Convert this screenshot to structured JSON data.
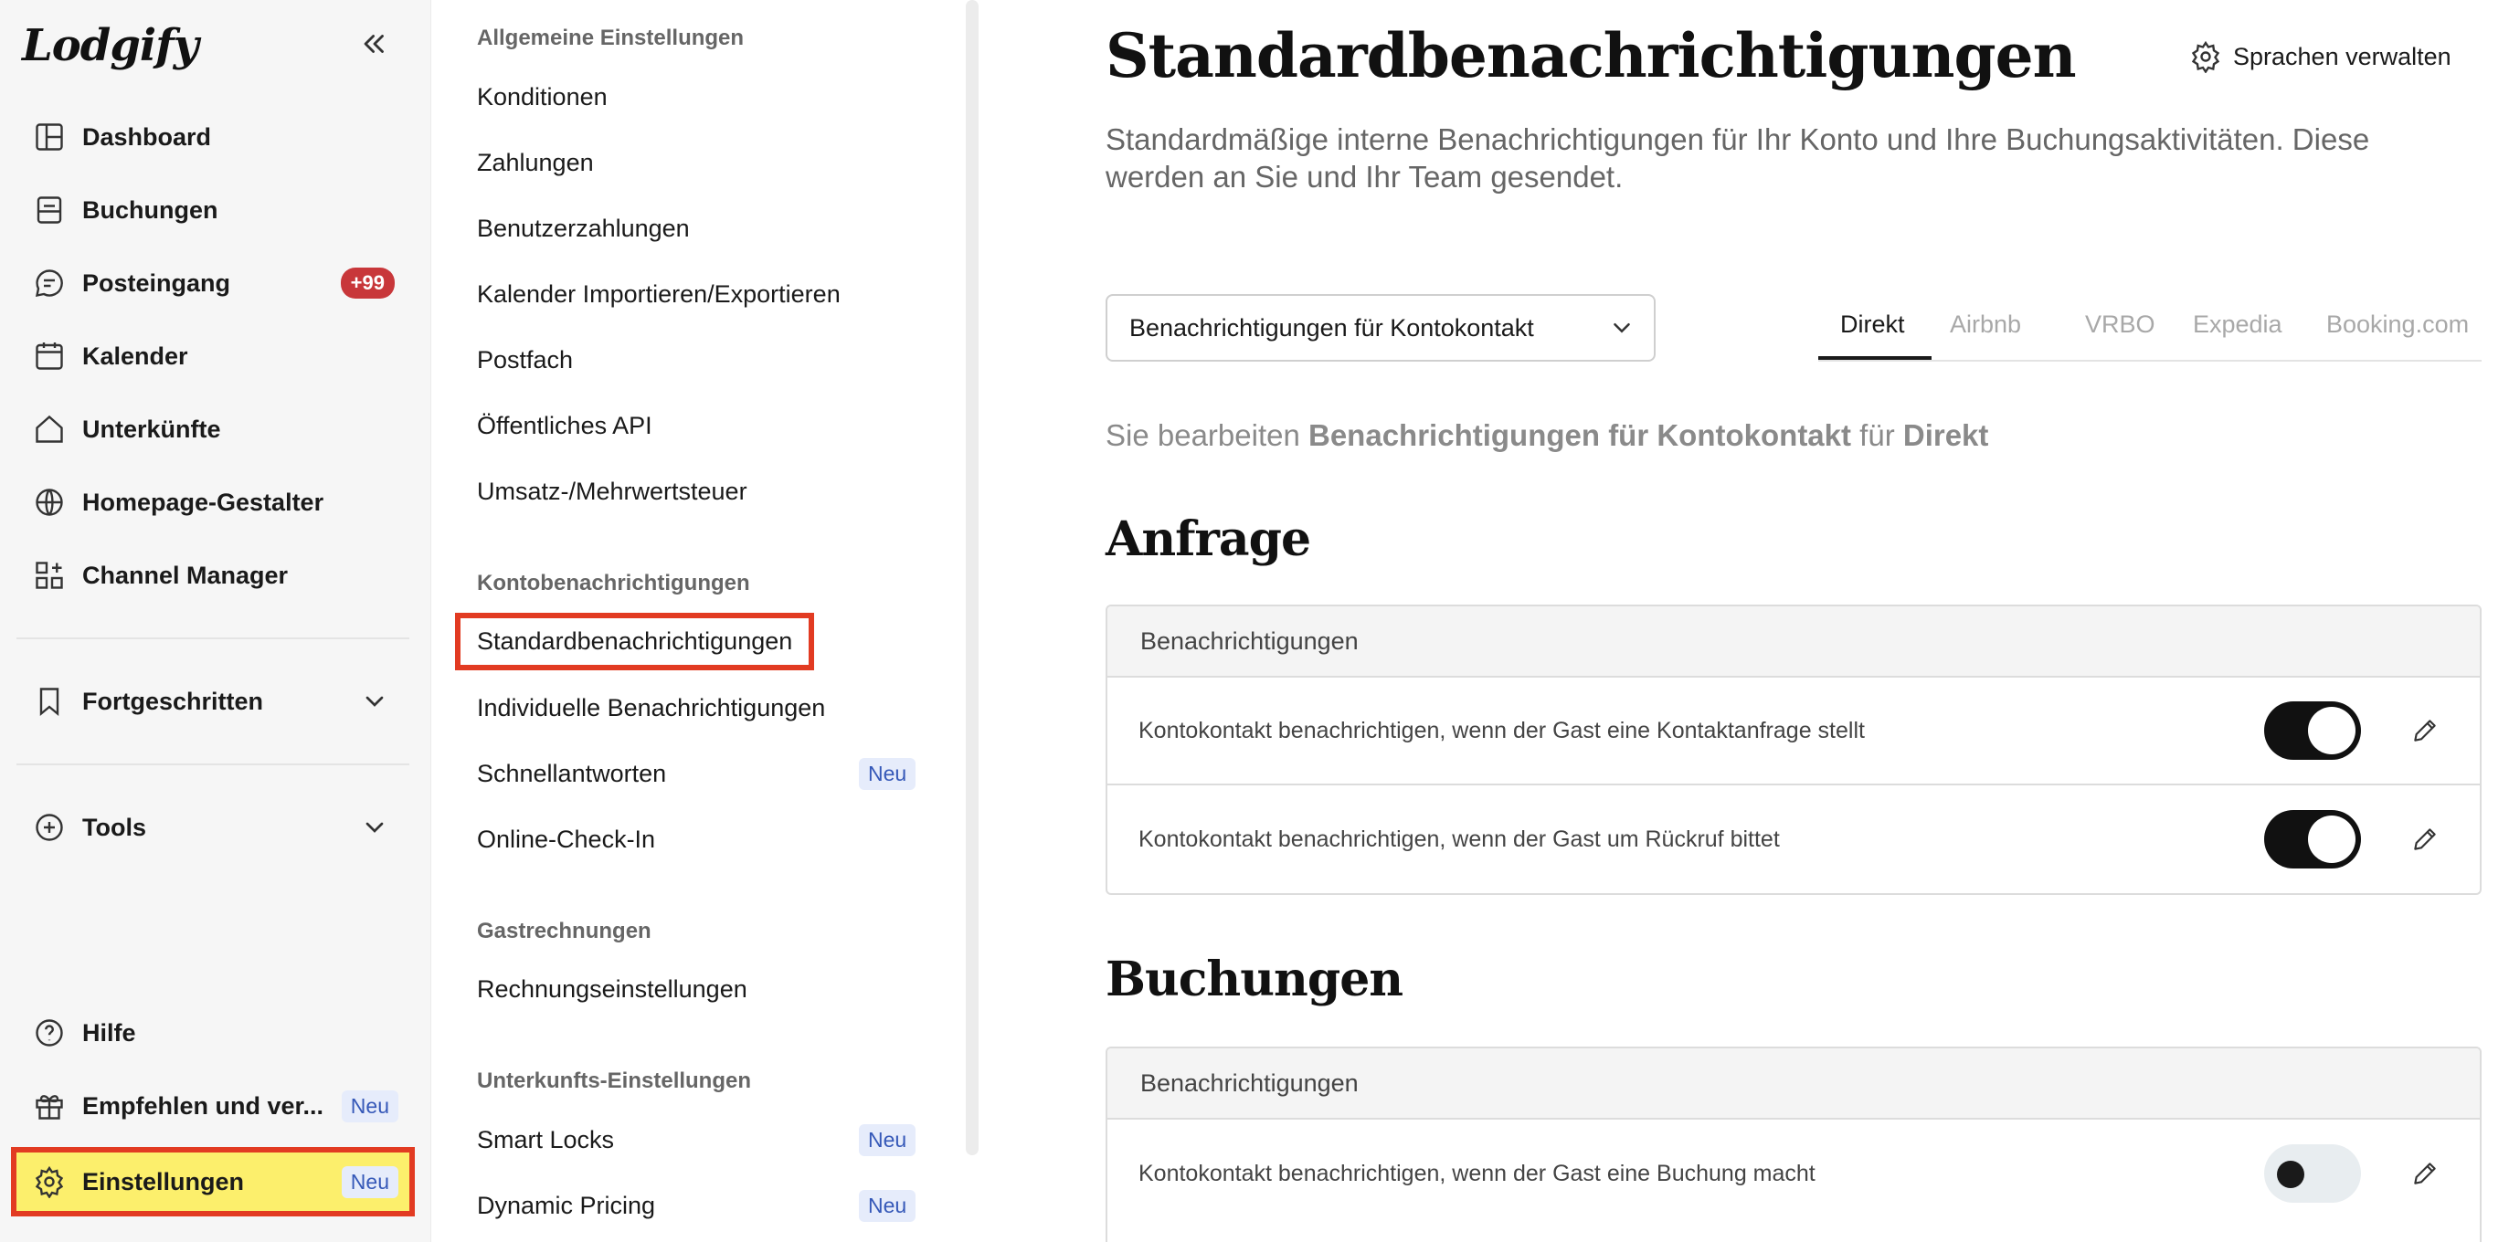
{
  "brand": {
    "logo": "Lodgify"
  },
  "sidebar": {
    "items": [
      {
        "label": "Dashboard",
        "icon": "dashboard-icon"
      },
      {
        "label": "Buchungen",
        "icon": "bookings-icon"
      },
      {
        "label": "Posteingang",
        "icon": "inbox-icon",
        "badge": "+99"
      },
      {
        "label": "Kalender",
        "icon": "calendar-icon"
      },
      {
        "label": "Unterkünfte",
        "icon": "home-icon"
      },
      {
        "label": "Homepage-Gestalter",
        "icon": "globe-icon"
      },
      {
        "label": "Channel Manager",
        "icon": "channel-icon"
      }
    ],
    "groups": [
      {
        "label": "Fortgeschritten",
        "icon": "bookmark-icon"
      },
      {
        "label": "Tools",
        "icon": "plus-circle-icon"
      }
    ],
    "bottom": [
      {
        "label": "Hilfe",
        "icon": "help-icon"
      },
      {
        "label": "Empfehlen und ver...",
        "icon": "gift-icon",
        "badge": "Neu"
      },
      {
        "label": "Einstellungen",
        "icon": "gear-icon",
        "badge": "Neu",
        "active": true
      }
    ]
  },
  "settings_nav": {
    "sections": [
      {
        "title": "Allgemeine Einstellungen",
        "items": [
          {
            "label": "Konditionen"
          },
          {
            "label": "Zahlungen"
          },
          {
            "label": "Benutzerzahlungen"
          },
          {
            "label": "Kalender Importieren/Exportieren"
          },
          {
            "label": "Postfach"
          },
          {
            "label": "Öffentliches API"
          },
          {
            "label": "Umsatz-/Mehrwertsteuer"
          }
        ]
      },
      {
        "title": "Kontobenachrichtigungen",
        "items": [
          {
            "label": "Standardbenachrichtigungen",
            "current": true
          },
          {
            "label": "Individuelle Benachrichtigungen"
          },
          {
            "label": "Schnellantworten",
            "badge": "Neu"
          },
          {
            "label": "Online-Check-In"
          }
        ]
      },
      {
        "title": "Gastrechnungen",
        "items": [
          {
            "label": "Rechnungseinstellungen"
          }
        ]
      },
      {
        "title": "Unterkunfts-Einstellungen",
        "items": [
          {
            "label": "Smart Locks",
            "badge": "Neu"
          },
          {
            "label": "Dynamic Pricing",
            "badge": "Neu"
          }
        ]
      }
    ]
  },
  "main": {
    "title": "Standardbenachrichtigungen",
    "manage_languages": "Sprachen verwalten",
    "description": "Standardmäßige interne Benachrichtigungen für Ihr Konto und Ihre Buchungsaktivitäten. Diese werden an Sie und Ihr Team gesendet.",
    "select_value": "Benachrichtigungen für Kontokontakt",
    "tabs": [
      {
        "label": "Direkt",
        "active": true
      },
      {
        "label": "Airbnb"
      },
      {
        "label": "VRBO"
      },
      {
        "label": "Expedia"
      },
      {
        "label": "Booking.com"
      }
    ],
    "editing": {
      "prefix": "Sie bearbeiten",
      "target": "Benachrichtigungen für Kontokontakt",
      "middle": "für",
      "channel": "Direkt"
    },
    "sections": [
      {
        "title": "Anfrage",
        "header": "Benachrichtigungen",
        "rows": [
          {
            "text": "Kontokontakt benachrichtigen, wenn der Gast eine Kontaktanfrage stellt",
            "enabled": true
          },
          {
            "text": "Kontokontakt benachrichtigen, wenn der Gast um Rückruf bittet",
            "enabled": true
          }
        ]
      },
      {
        "title": "Buchungen",
        "header": "Benachrichtigungen",
        "rows": [
          {
            "text": "Kontokontakt benachrichtigen, wenn der Gast eine Buchung macht",
            "enabled": false
          }
        ]
      }
    ]
  },
  "colors": {
    "highlight_outline": "#e23b22",
    "active_nav_bg": "#fcef6c",
    "badge_red": "#c8373a",
    "badge_neu_text": "#3558b8"
  }
}
